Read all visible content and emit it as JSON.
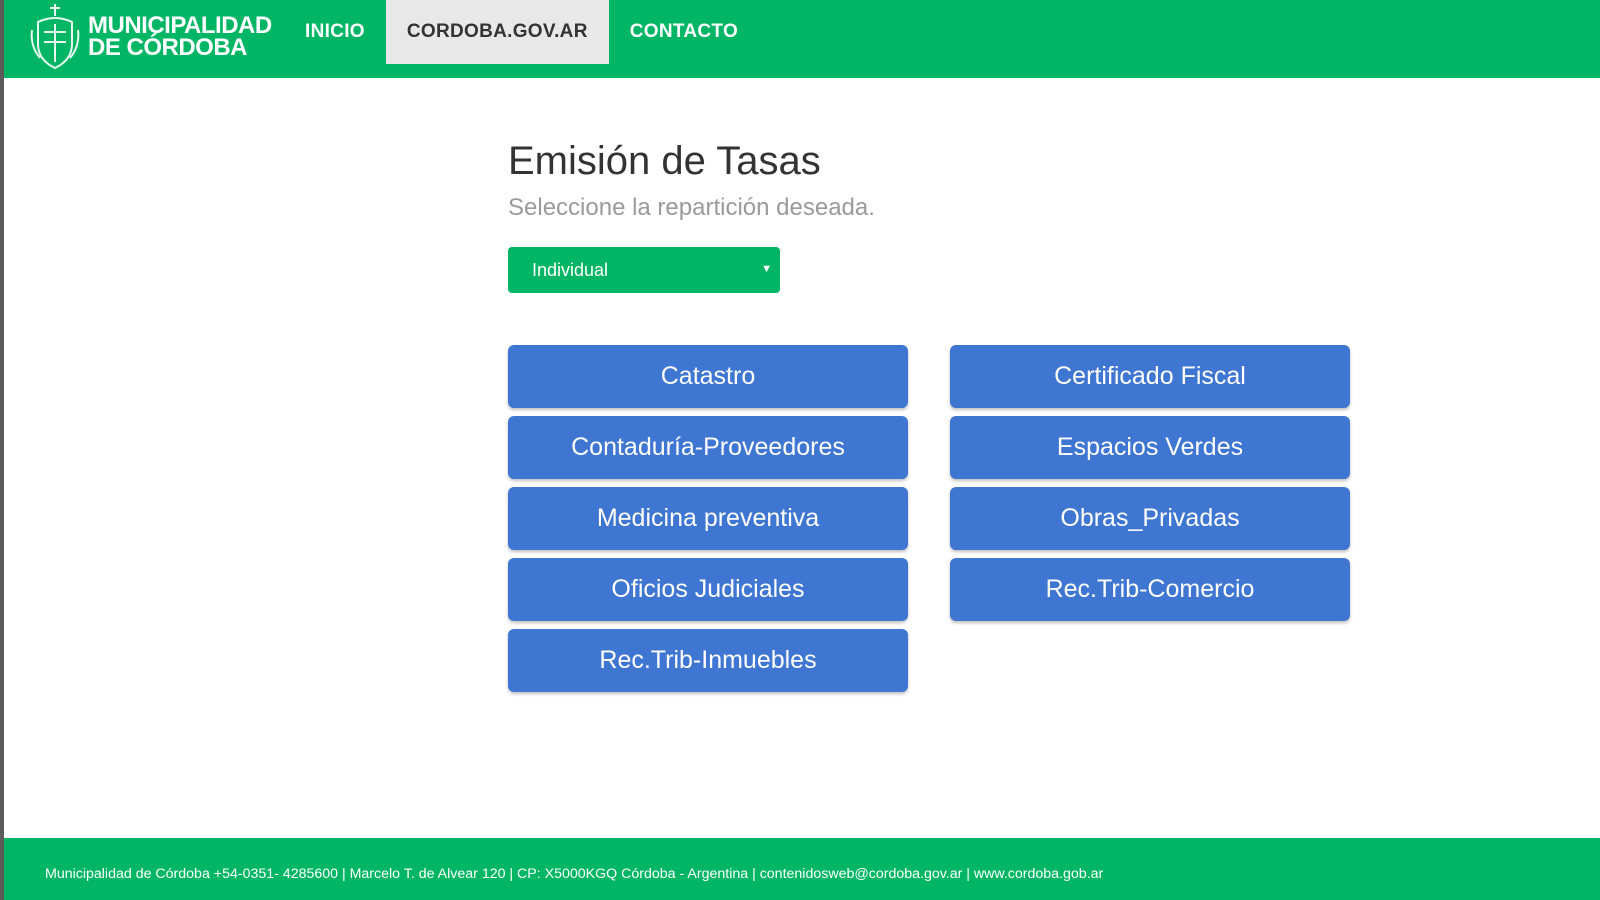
{
  "header": {
    "logo": {
      "line1": "MUNICIPALIDAD",
      "line2": "DE CÓRDOBA",
      "icon": "municipal-crest-icon"
    },
    "nav": [
      {
        "label": "INICIO",
        "active": false
      },
      {
        "label": "CORDOBA.GOV.AR",
        "active": true
      },
      {
        "label": "CONTACTO",
        "active": false
      }
    ]
  },
  "main": {
    "title": "Emisión de Tasas",
    "subtitle": "Seleccione la repartición deseada.",
    "select": {
      "value": "Individual",
      "icon": "caret-down-icon"
    },
    "buttons": [
      "Catastro",
      "Certificado Fiscal",
      "Contaduría-Proveedores",
      "Espacios Verdes",
      "Medicina preventiva",
      "Obras_Privadas",
      "Oficios Judiciales",
      "Rec.Trib-Comercio",
      "Rec.Trib-Inmuebles"
    ]
  },
  "footer": {
    "text": "Municipalidad de Córdoba +54-0351- 4285600 | Marcelo T. de Alvear 120 | CP: X5000KGQ Córdoba - Argentina | contenidosweb@cordoba.gov.ar | www.cordoba.gob.ar"
  },
  "colors": {
    "brand_green": "#00b664",
    "button_blue": "#3f76d2",
    "active_tab_bg": "#e8e8e8"
  }
}
